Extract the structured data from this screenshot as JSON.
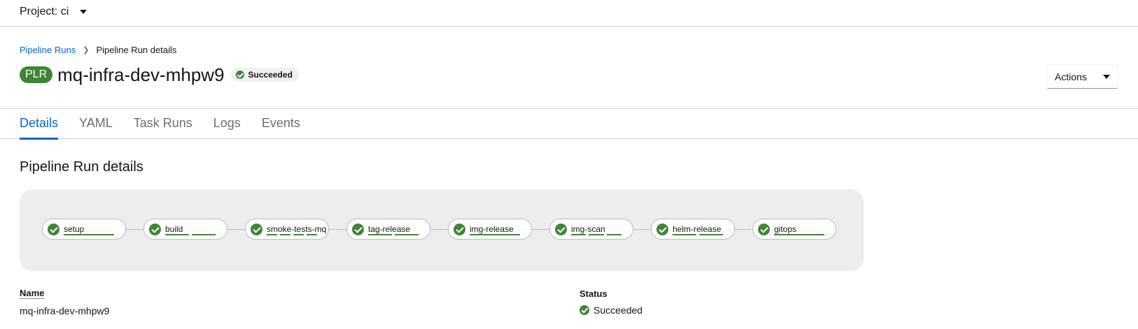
{
  "project": {
    "label": "Project: ci"
  },
  "breadcrumb": {
    "parent": "Pipeline Runs",
    "current": "Pipeline Run details"
  },
  "header": {
    "badge": "PLR",
    "title": "mq-infra-dev-mhpw9",
    "status": "Succeeded",
    "actions_label": "Actions"
  },
  "tabs": [
    {
      "label": "Details",
      "active": true
    },
    {
      "label": "YAML"
    },
    {
      "label": "Task Runs"
    },
    {
      "label": "Logs"
    },
    {
      "label": "Events"
    }
  ],
  "section": {
    "title": "Pipeline Run details"
  },
  "pipeline": {
    "tasks": [
      {
        "name": "setup",
        "steps": 1
      },
      {
        "name": "build",
        "steps": 2
      },
      {
        "name": "smoke-tests-mq",
        "steps": 4
      },
      {
        "name": "tag-release",
        "steps": 2
      },
      {
        "name": "img-release",
        "steps": 1
      },
      {
        "name": "img-scan",
        "steps": 3
      },
      {
        "name": "helm-release",
        "steps": 2
      },
      {
        "name": "gitops",
        "steps": 1
      }
    ],
    "status_color": "#3e8635"
  },
  "details": {
    "name_label": "Name",
    "name_value": "mq-infra-dev-mhpw9",
    "status_label": "Status",
    "status_value": "Succeeded"
  },
  "colors": {
    "accent": "#0066cc",
    "success": "#3e8635"
  }
}
